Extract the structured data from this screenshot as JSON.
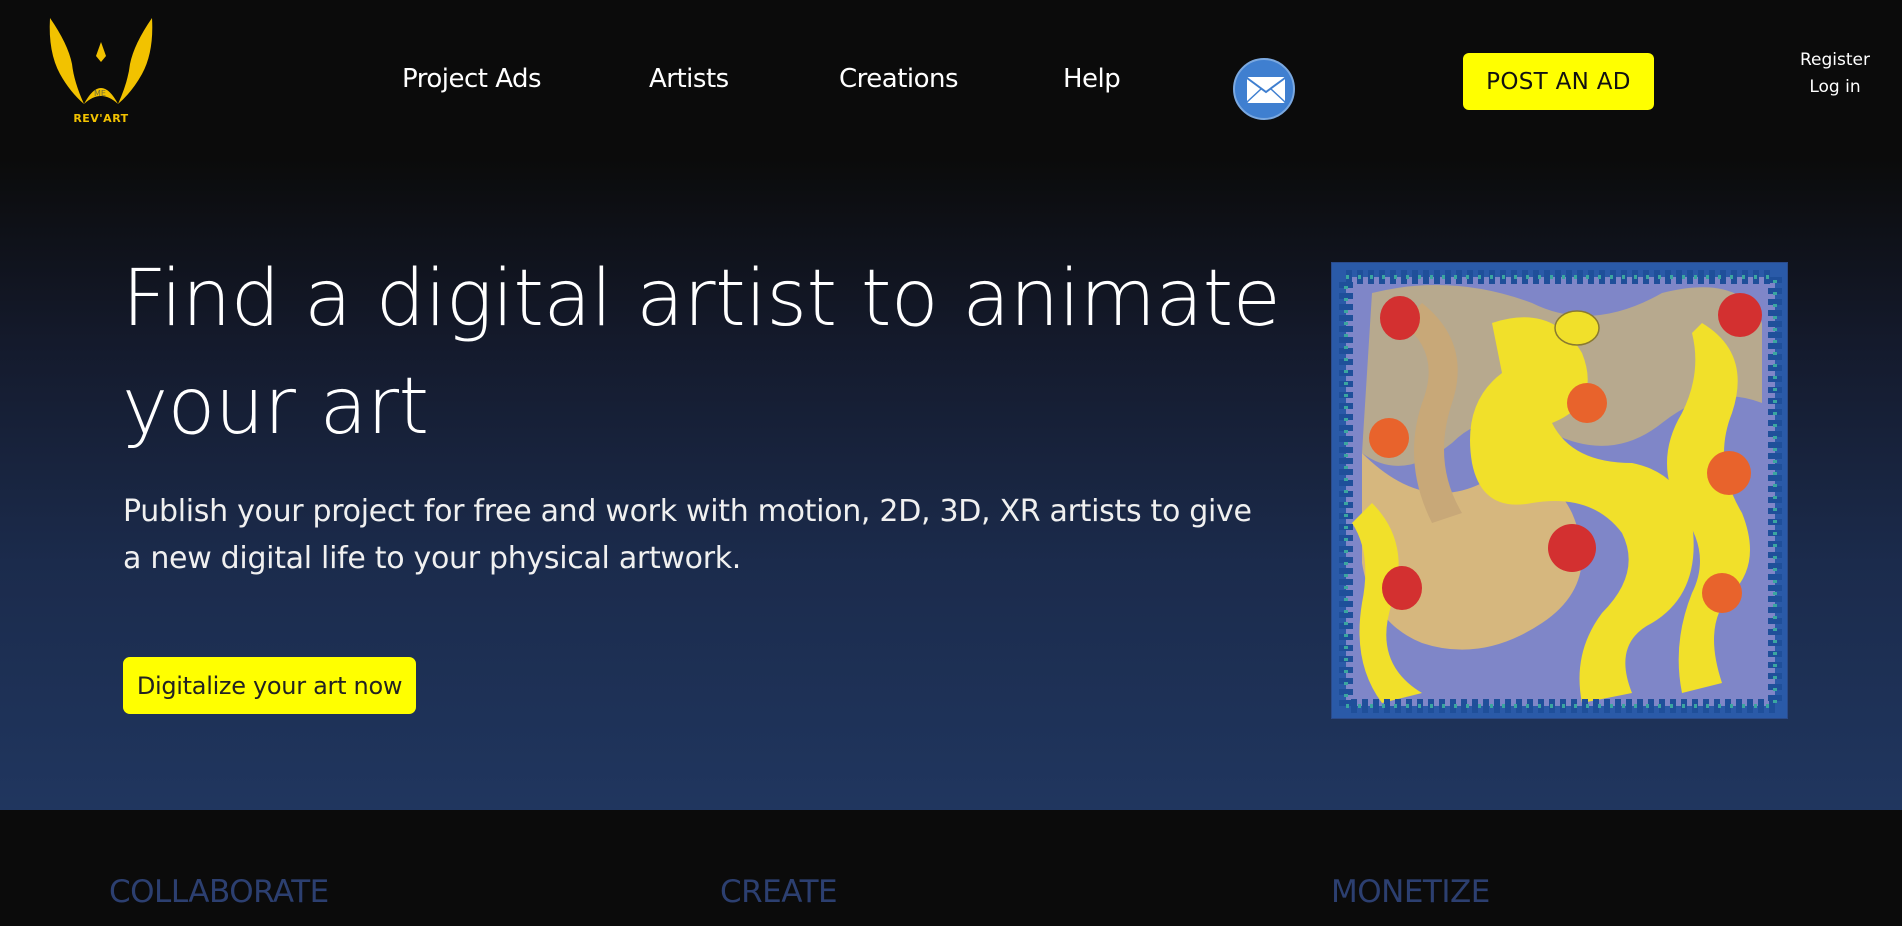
{
  "brand": {
    "logo_text": "REV'ART",
    "accent_color": "#ffff00",
    "logo_color": "#f2c200"
  },
  "nav": {
    "items": [
      {
        "label": "Project Ads"
      },
      {
        "label": "Artists"
      },
      {
        "label": "Creations"
      },
      {
        "label": "Help"
      }
    ],
    "mail_icon": "envelope-icon",
    "post_ad_label": "POST AN AD",
    "register_label": "Register",
    "login_label": "Log in"
  },
  "hero": {
    "title": "Find a digital artist to animate your art",
    "subtitle": "Publish your project for free and work with motion, 2D, 3D, XR artists to give a new digital life to your physical artwork.",
    "cta_label": "Digitalize your art now",
    "image": "painting-artwork"
  },
  "features": [
    {
      "label": "COLLABORATE"
    },
    {
      "label": "CREATE"
    },
    {
      "label": "MONETIZE"
    }
  ]
}
